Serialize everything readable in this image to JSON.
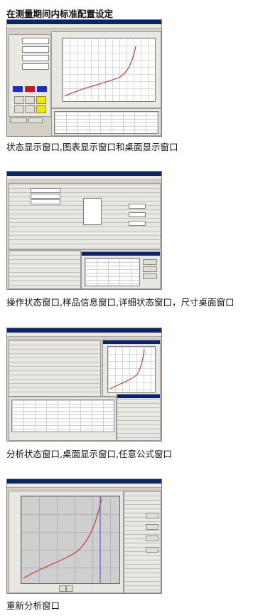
{
  "heading": "在测量期间内标准配置设定",
  "captions": {
    "c1": "状态显示窗口,图表显示窗口和桌面显示窗口",
    "c2": "操作状态窗口,样品信息窗口,详细状态窗口，尺寸桌面窗口",
    "c3": "分析状态窗口,桌面显示窗口,任意公式窗口",
    "c4": "重新分析窗口"
  },
  "colors": {
    "curve": "#c03a3a",
    "titlebar": "#0a246a",
    "window_bg": "#d4d0c8"
  }
}
